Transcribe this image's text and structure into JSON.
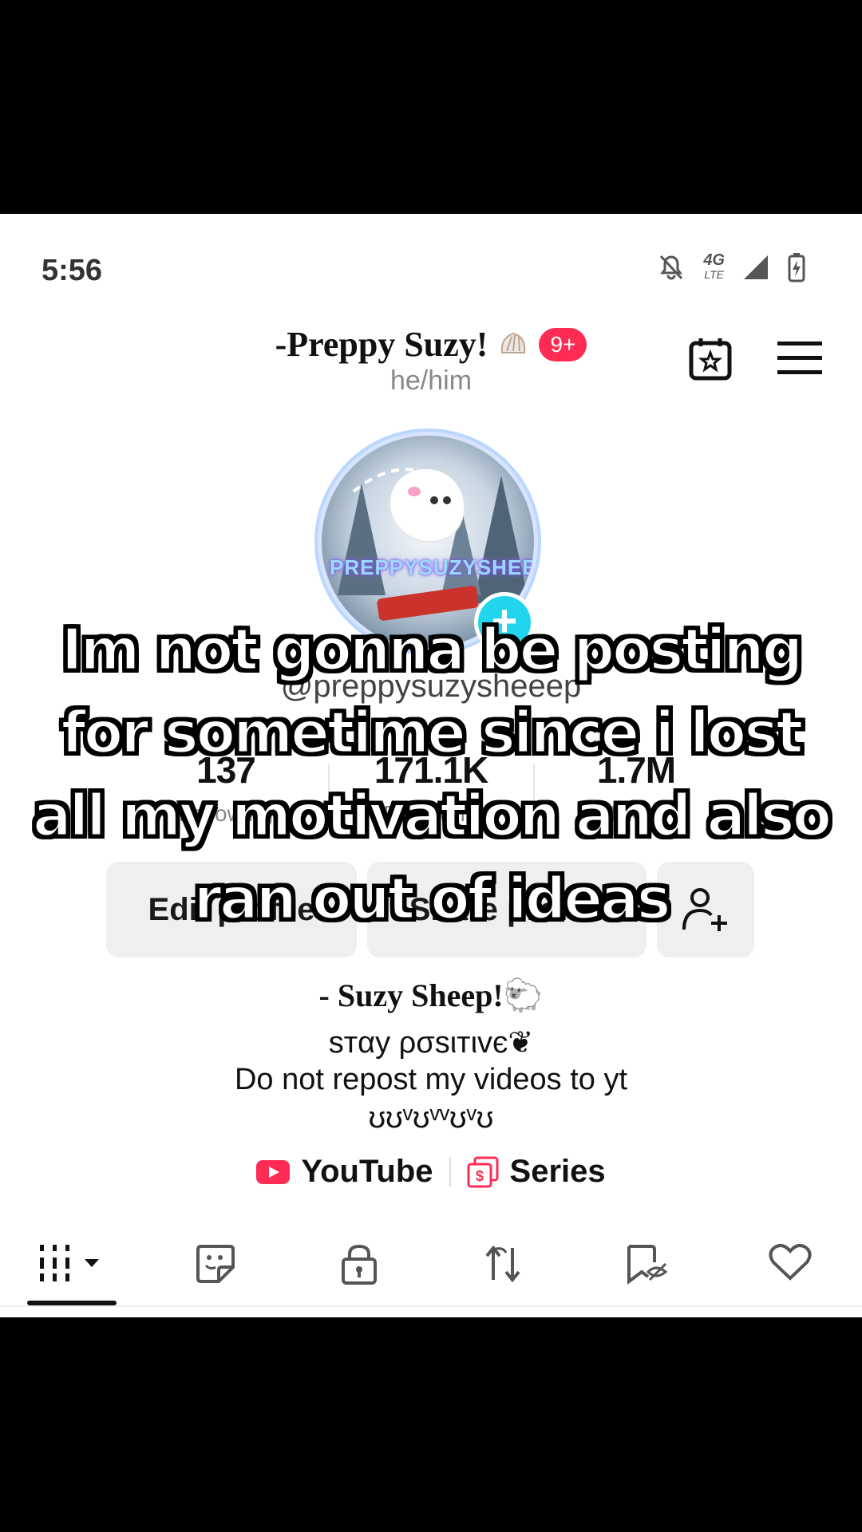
{
  "status_bar": {
    "time": "5:56",
    "network": "4G",
    "network_sub": "LTE"
  },
  "header": {
    "title": "-Preppy Suzy!",
    "title_emoji": "shell-icon",
    "notification_badge": "9+",
    "pronouns": "he/him"
  },
  "profile": {
    "avatar_text": "PREPPYSUZYSHEEEP",
    "handle": "@preppysuzysheeep",
    "stats": [
      {
        "value": "137",
        "label": "Following"
      },
      {
        "value": "171.1K",
        "label": "Followers"
      },
      {
        "value": "1.7M",
        "label": "Likes"
      }
    ],
    "buttons": {
      "edit": "Edit profile",
      "share": "Share profile"
    },
    "bio": {
      "name": "- Suzy Sheep!🐑",
      "line1": "sтαy ρσѕιтιvє❦",
      "line2": "Do not repost my videos to yt",
      "line3": "ʊʊᵛʊᵛᵛʊᵛʊ"
    },
    "links": [
      {
        "label": "YouTube",
        "icon": "youtube-icon"
      },
      {
        "label": "Series",
        "icon": "series-icon"
      }
    ]
  },
  "tabs": [
    "videos-grid-icon",
    "stickers-icon",
    "lock-icon",
    "repost-icon",
    "hidden-bookmark-icon",
    "heart-icon"
  ],
  "overlay": {
    "caption": "Im not gonna be posting for sometime since i lost all my motivation and also ran out of ideas"
  },
  "colors": {
    "accent_red": "#fe2c55",
    "accent_cyan": "#20d5ec",
    "button_bg": "#efefef"
  }
}
